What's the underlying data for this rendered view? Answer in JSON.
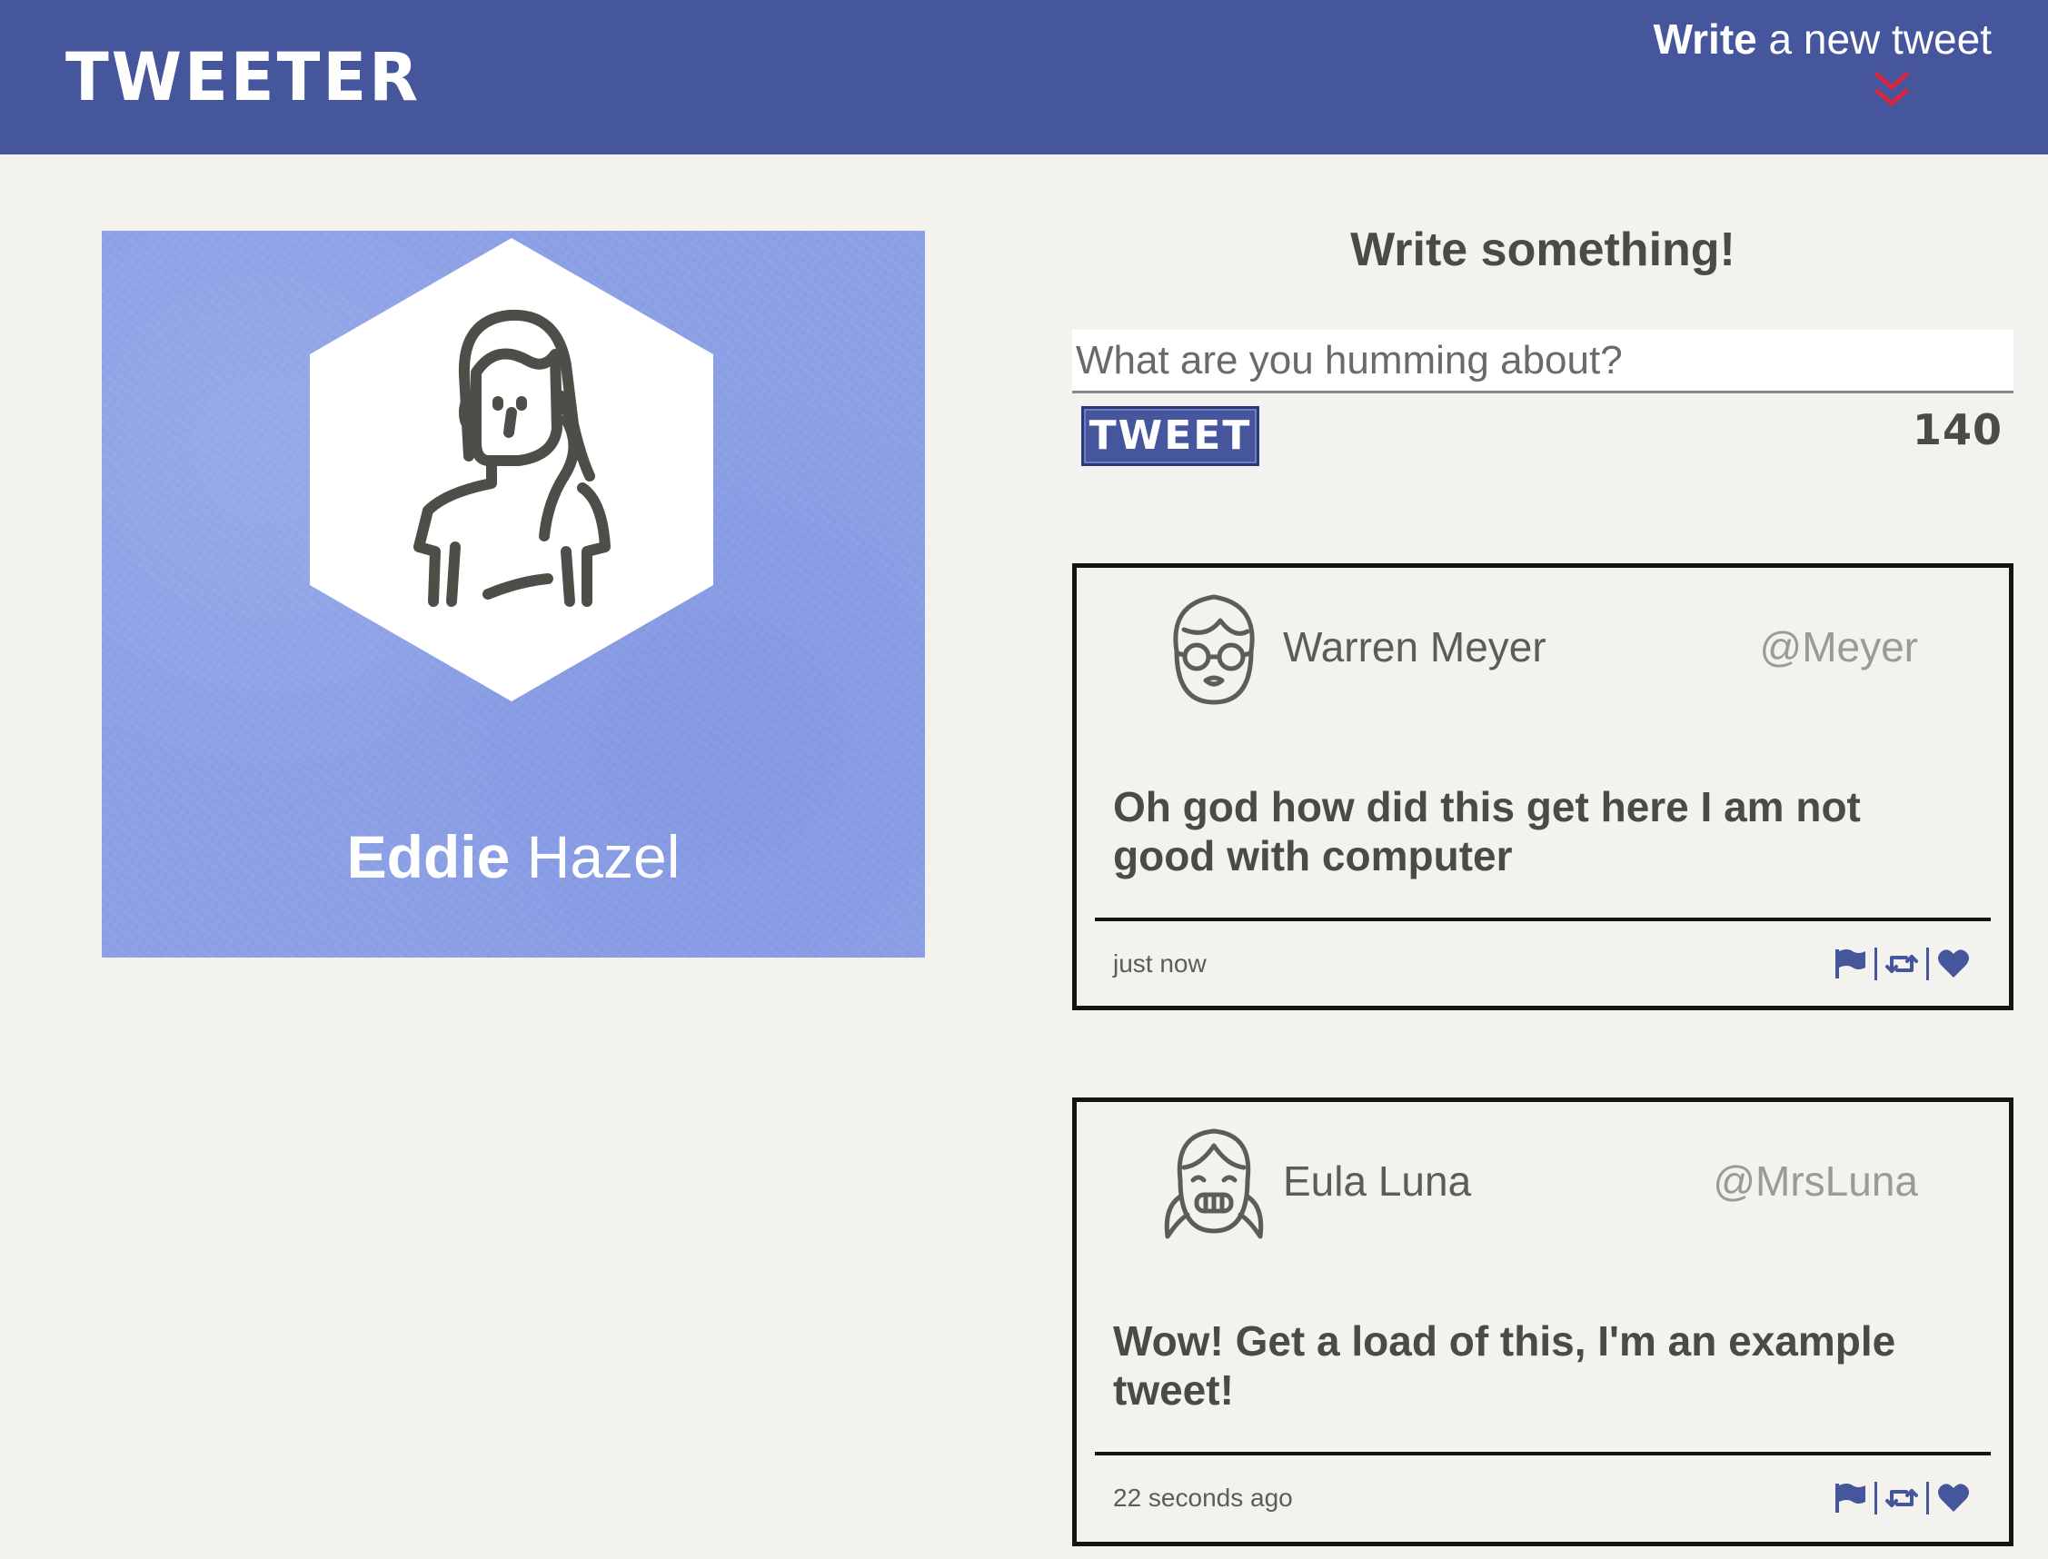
{
  "header": {
    "brand": "TWEETER",
    "compose_toggle": {
      "bold": "Write",
      "rest": " a new tweet"
    },
    "colors": {
      "bar": "#46569d",
      "chevron": "#d7263d"
    }
  },
  "profile": {
    "first_name": "Eddie",
    "last_name": " Hazel",
    "avatar_icon": "woman-avatar-icon",
    "background": "#8ca0e6"
  },
  "compose": {
    "heading": "Write something!",
    "placeholder": "What are you humming about?",
    "value": "",
    "button_label": "TWEET",
    "counter": "140"
  },
  "tweets": [
    {
      "author": "Warren Meyer",
      "handle": "@Meyer",
      "avatar_icon": "man-with-glasses-avatar-icon",
      "text": "Oh god how did this get here I am not good with computer",
      "time": "just now",
      "actions": [
        "flag-icon",
        "retweet-icon",
        "heart-icon"
      ]
    },
    {
      "author": "Eula Luna",
      "handle": "@MrsLuna",
      "avatar_icon": "girl-with-pigtails-avatar-icon",
      "text": "Wow! Get a load of this, I'm an example tweet!",
      "time": "22 seconds ago",
      "actions": [
        "flag-icon",
        "retweet-icon",
        "heart-icon"
      ]
    }
  ]
}
